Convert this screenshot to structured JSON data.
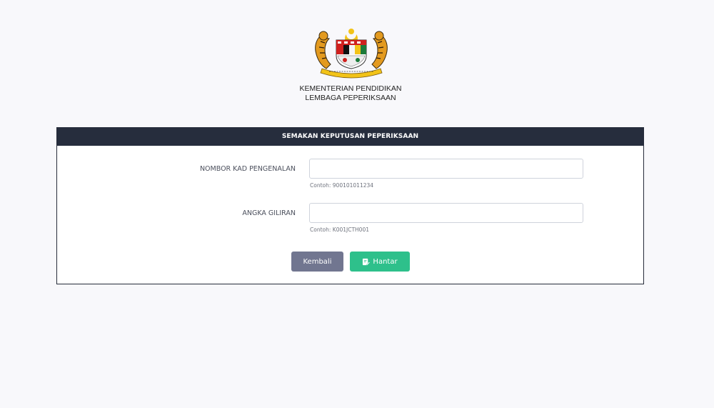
{
  "org": {
    "line1": "KEMENTERIAN PENDIDIKAN",
    "line2": "LEMBAGA PEPERIKSAAN"
  },
  "form": {
    "title": "SEMAKAN KEPUTUSAN PEPERIKSAAN",
    "ic_label": "NOMBOR KAD PENGENALAN",
    "ic_value": "",
    "ic_hint": "Contoh: 900101011234",
    "index_label": "ANGKA GILIRAN",
    "index_value": "",
    "index_hint": "Contoh: K001JCTH001"
  },
  "buttons": {
    "back_label": "Kembali",
    "submit_label": "Hantar",
    "submit_icon": "edit-icon"
  },
  "colors": {
    "header_bg": "#262d3d",
    "back_btn": "#717690",
    "submit_btn": "#2ec08b",
    "page_bg": "#f8f8fb"
  }
}
